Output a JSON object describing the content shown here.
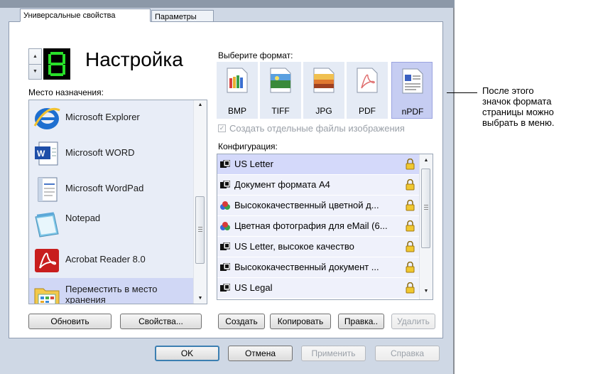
{
  "tabs": [
    "Универсальные свойства",
    "Параметры"
  ],
  "preset": {
    "number": "8",
    "title": "Настройка"
  },
  "destination": {
    "label": "Место назначения:",
    "items": [
      {
        "name": "Microsoft Explorer",
        "icon": "internet-explorer-icon"
      },
      {
        "name": "Microsoft WORD",
        "icon": "word-icon"
      },
      {
        "name": "Microsoft WordPad",
        "icon": "wordpad-icon"
      },
      {
        "name": "Notepad",
        "icon": "notepad-icon"
      },
      {
        "name": "Acrobat Reader 8.0",
        "icon": "acrobat-icon"
      },
      {
        "name_line1": "Переместить в место",
        "name_line2": "хранения",
        "icon": "storage-folder-icon"
      }
    ],
    "selected_index": 5,
    "refresh_label": "Обновить",
    "properties_label": "Свойства..."
  },
  "format": {
    "label": "Выберите формат:",
    "items": [
      "BMP",
      "TIFF",
      "JPG",
      "PDF",
      "nPDF"
    ],
    "selected": "nPDF",
    "separate_files_label": "Создать отдельные файлы изображения",
    "separate_files_checked": true,
    "separate_files_enabled": false
  },
  "configuration": {
    "label": "Конфигурация:",
    "items": [
      "US Letter",
      "Документ формата A4",
      "Высококачественный цветной д...",
      "Цветная фотография для eMail (6...",
      "US Letter, высокое качество",
      "Высококачественный документ ...",
      "US Legal"
    ],
    "selected_index": 0,
    "create_label": "Создать",
    "copy_label": "Копировать",
    "edit_label": "Правка..",
    "delete_label": "Удалить"
  },
  "dialog_buttons": {
    "ok": "OK",
    "cancel": "Отмена",
    "apply": "Применить",
    "help": "Справка"
  },
  "callout": [
    "После этого",
    "значок формата",
    "страницы можно",
    "выбрать в меню."
  ]
}
